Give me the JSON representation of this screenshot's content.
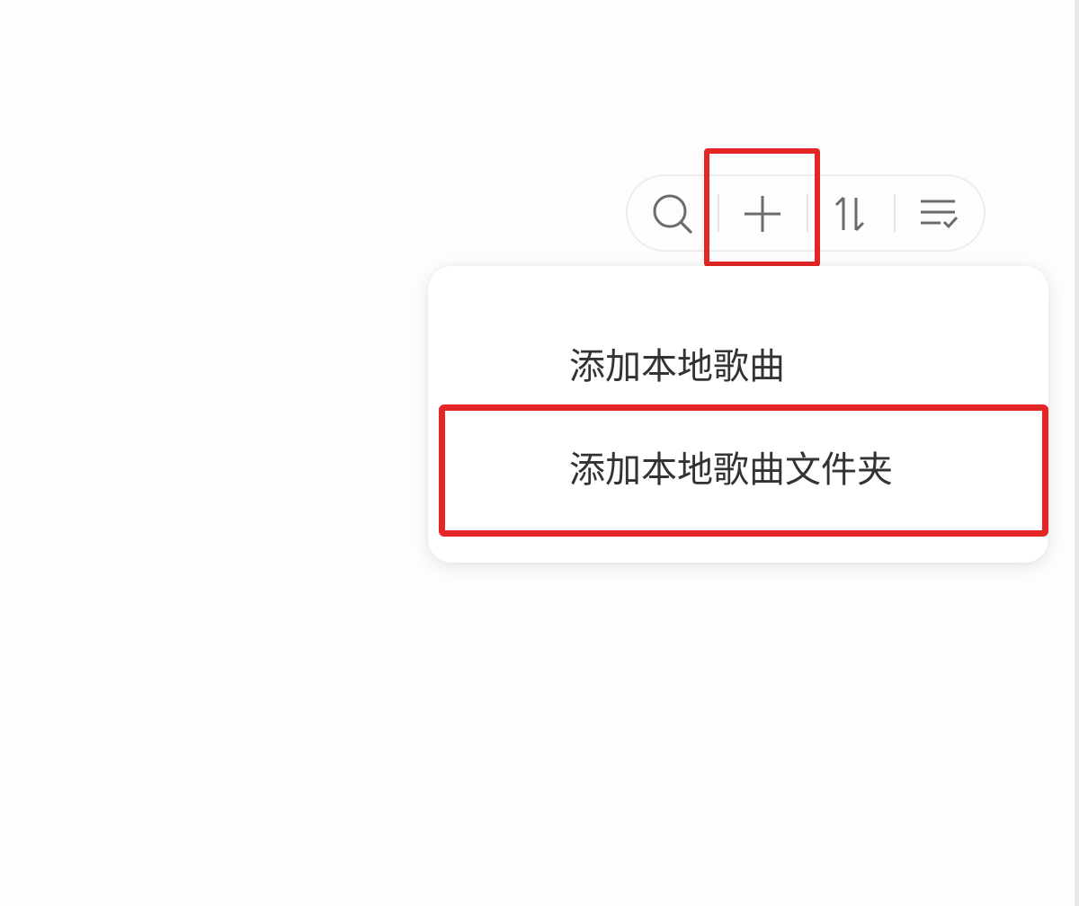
{
  "toolbar": {
    "buttons": [
      {
        "icon": "search-icon"
      },
      {
        "icon": "plus-icon"
      },
      {
        "icon": "sort-icon"
      },
      {
        "icon": "list-check-icon"
      }
    ]
  },
  "add_menu": {
    "items": [
      {
        "label": "添加本地歌曲"
      },
      {
        "label": "添加本地歌曲文件夹"
      }
    ]
  },
  "colors": {
    "highlight": "#e52626",
    "icon": "#6b6b6e",
    "text": "#333333",
    "menu_background": "#ffffff"
  }
}
